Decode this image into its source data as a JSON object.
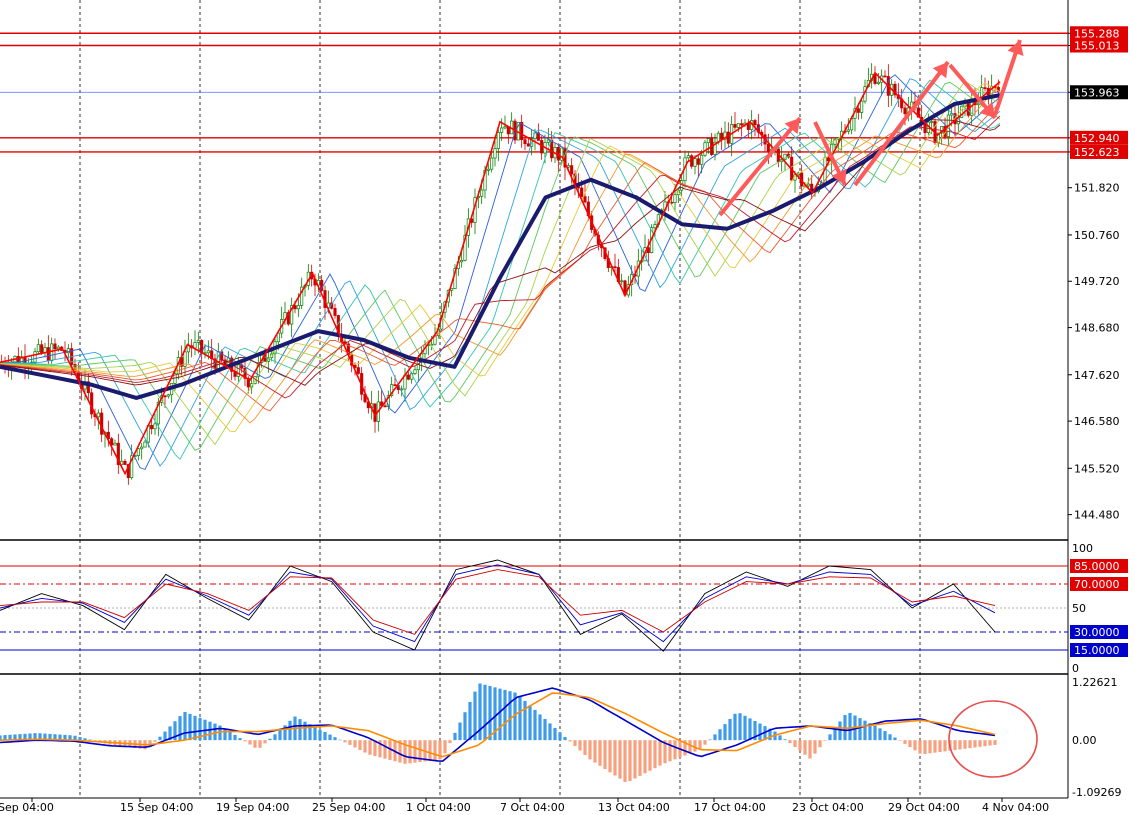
{
  "chart_data": [
    {
      "type": "candlestick",
      "panel": "price",
      "y_ticks": [
        "155.288",
        "155.013",
        "153.963",
        "152.940",
        "152.623",
        "151.820",
        "150.760",
        "149.720",
        "148.680",
        "147.620",
        "146.580",
        "145.520",
        "144.480"
      ],
      "ylim": [
        144.0,
        155.9
      ],
      "horizontal_levels": [
        {
          "value": 155.288,
          "label": "155.288",
          "color": "#e00000"
        },
        {
          "value": 155.013,
          "label": "155.013",
          "color": "#e00000"
        },
        {
          "value": 152.94,
          "label": "152.940",
          "color": "#e00000"
        },
        {
          "value": 152.623,
          "label": "152.623",
          "color": "#e00000"
        }
      ],
      "current_price": {
        "value": 153.963,
        "label": "153.963"
      },
      "x_labels": [
        "Sep 04:00",
        "15 Sep 04:00",
        "19 Sep 04:00",
        "25 Sep 04:00",
        "1 Oct 04:00",
        "7 Oct 04:00",
        "13 Oct 04:00",
        "17 Oct 04:00",
        "23 Oct 04:00",
        "29 Oct 04:00",
        "4 Nov 04:00"
      ],
      "zigzag": [
        147.9,
        148.2,
        145.4,
        148.3,
        147.5,
        149.9,
        146.7,
        148.6,
        153.3,
        152.5,
        149.4,
        152.4,
        153.3,
        151.7,
        154.4,
        153.0,
        154.2
      ],
      "ma_slow": [
        147.8,
        147.6,
        147.4,
        147.1,
        147.4,
        147.8,
        148.2,
        148.6,
        148.4,
        148.0,
        147.8,
        149.8,
        151.6,
        152.0,
        151.6,
        151.0,
        150.9,
        151.3,
        151.8,
        152.4,
        153.1,
        153.7,
        153.9
      ],
      "colors": {
        "up": "#008000",
        "down": "#cc0000",
        "ma_slow": "#1a1a6e",
        "zigzag": "#ff0000",
        "arrows": "#ff5a5a"
      }
    },
    {
      "type": "line",
      "panel": "oscillator",
      "ylim": [
        0,
        100
      ],
      "y_ticks": [
        "100",
        "50",
        "0"
      ],
      "levels": [
        {
          "value": 85,
          "label": "85.0000",
          "color": "#e00000"
        },
        {
          "value": 70,
          "label": "70.0000",
          "color": "#e00000"
        },
        {
          "value": 30,
          "label": "30.0000",
          "color": "#0000cc"
        },
        {
          "value": 15,
          "label": "15.0000",
          "color": "#0000cc"
        }
      ],
      "series": [
        {
          "color": "#000000",
          "values": [
            48,
            62,
            52,
            32,
            78,
            58,
            40,
            85,
            72,
            30,
            15,
            82,
            90,
            78,
            28,
            45,
            14,
            62,
            80,
            68,
            85,
            82,
            50,
            70,
            30
          ]
        },
        {
          "color": "#0000cc",
          "values": [
            50,
            58,
            54,
            38,
            74,
            60,
            44,
            80,
            74,
            35,
            22,
            78,
            86,
            78,
            36,
            46,
            22,
            58,
            76,
            70,
            80,
            78,
            52,
            64,
            46
          ]
        },
        {
          "color": "#cc0000",
          "values": [
            52,
            55,
            55,
            42,
            70,
            62,
            48,
            76,
            75,
            40,
            28,
            74,
            82,
            76,
            44,
            48,
            30,
            55,
            72,
            70,
            76,
            75,
            55,
            60,
            52
          ]
        }
      ]
    },
    {
      "type": "bar_and_line",
      "panel": "macd",
      "ylim": [
        -1.09269,
        1.22621
      ],
      "y_ticks": [
        "1.22621",
        "0.00",
        "-1.09269"
      ],
      "histogram": [
        0.1,
        0.15,
        0.1,
        -0.1,
        -0.2,
        0.6,
        0.3,
        -0.2,
        0.5,
        0.1,
        -0.3,
        -0.5,
        -0.4,
        1.2,
        1.0,
        0.3,
        -0.4,
        -0.9,
        -0.5,
        -0.2,
        0.6,
        0.2,
        -0.4,
        0.6,
        0.2,
        -0.3,
        -0.2,
        -0.1
      ],
      "macd_line": [
        -0.05,
        0.0,
        -0.02,
        -0.12,
        -0.15,
        0.15,
        0.25,
        0.12,
        0.3,
        0.32,
        0.05,
        -0.35,
        -0.45,
        0.2,
        0.9,
        1.1,
        0.85,
        0.4,
        -0.05,
        -0.35,
        -0.1,
        0.25,
        0.3,
        0.2,
        0.4,
        0.45,
        0.2,
        0.1
      ],
      "signal_line": [
        0.0,
        0.02,
        0.0,
        -0.05,
        -0.1,
        0.0,
        0.18,
        0.18,
        0.25,
        0.3,
        0.2,
        -0.1,
        -0.35,
        -0.1,
        0.55,
        1.0,
        0.9,
        0.55,
        0.15,
        -0.2,
        -0.22,
        0.1,
        0.3,
        0.25,
        0.35,
        0.42,
        0.3,
        0.12
      ],
      "colors": {
        "hist_pos": "#3d9bea",
        "hist_neg": "#f7a07e",
        "macd": "#0000cc",
        "signal": "#ff8c00",
        "highlight": "#e84c4c"
      }
    }
  ]
}
